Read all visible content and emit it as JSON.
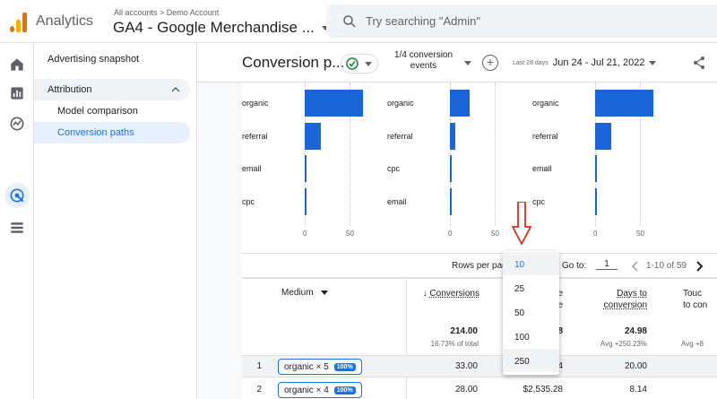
{
  "topbar": {
    "app_name": "Analytics",
    "breadcrumb": "All accounts > Demo Account",
    "property": "GA4 - Google Merchandise ...",
    "search_placeholder": "Try searching \"Admin\""
  },
  "sidebar": {
    "snapshot": "Advertising snapshot",
    "section": "Attribution",
    "items": [
      "Model comparison",
      "Conversion paths"
    ]
  },
  "header": {
    "title": "Conversion p...",
    "conv_events_line1": "1/4 conversion",
    "conv_events_line2": "events",
    "date_prefix": "Last 28 days",
    "date_range": "Jun 24 - Jul 21, 2022"
  },
  "charts": [
    {
      "labels": [
        "organic",
        "referral",
        "email",
        "cpc"
      ],
      "values": [
        65,
        18,
        2,
        2
      ],
      "ticks": [
        "0",
        "50"
      ]
    },
    {
      "labels": [
        "organic",
        "referral",
        "cpc",
        "email"
      ],
      "values": [
        22,
        6,
        2,
        2
      ],
      "ticks": [
        "0",
        "50"
      ]
    },
    {
      "labels": [
        "organic",
        "referral",
        "email",
        "cpc"
      ],
      "values": [
        65,
        18,
        2,
        2
      ],
      "ticks": [
        "0",
        "50"
      ]
    }
  ],
  "pager": {
    "rows_label": "Rows per page",
    "goto_label": "Go to:",
    "goto_value": "1",
    "range": "1-10 of 59"
  },
  "dropdown_options": [
    "10",
    "25",
    "50",
    "100",
    "250"
  ],
  "table": {
    "col_medium": "Medium",
    "col_conversions": "Conversions",
    "col_revenue_partial": "e",
    "col_revenue_partial2": "e",
    "col_days_line1": "Days to",
    "col_days_line2": "conversion",
    "col_touch_line1": "Touc",
    "col_touch_line2": "to con",
    "totals": {
      "conversions": "214.00",
      "conversions_sub": "16.73% of total",
      "revenue_partial": "8",
      "days": "24.98",
      "days_sub": "Avg +250.23%",
      "touch_sub": "Avg +8"
    },
    "rows": [
      {
        "index": "1",
        "path": "organic × 5",
        "pct": "100%",
        "conversions": "33.00",
        "revenue": "4",
        "days": "20.00"
      },
      {
        "index": "2",
        "path": "organic × 4",
        "pct": "100%",
        "conversions": "28.00",
        "revenue": "$2,535.28",
        "days": "8.14"
      }
    ]
  },
  "colors": {
    "bar": "#1a66d9",
    "accent": "#1a73e8",
    "arrow": "#d93025"
  }
}
